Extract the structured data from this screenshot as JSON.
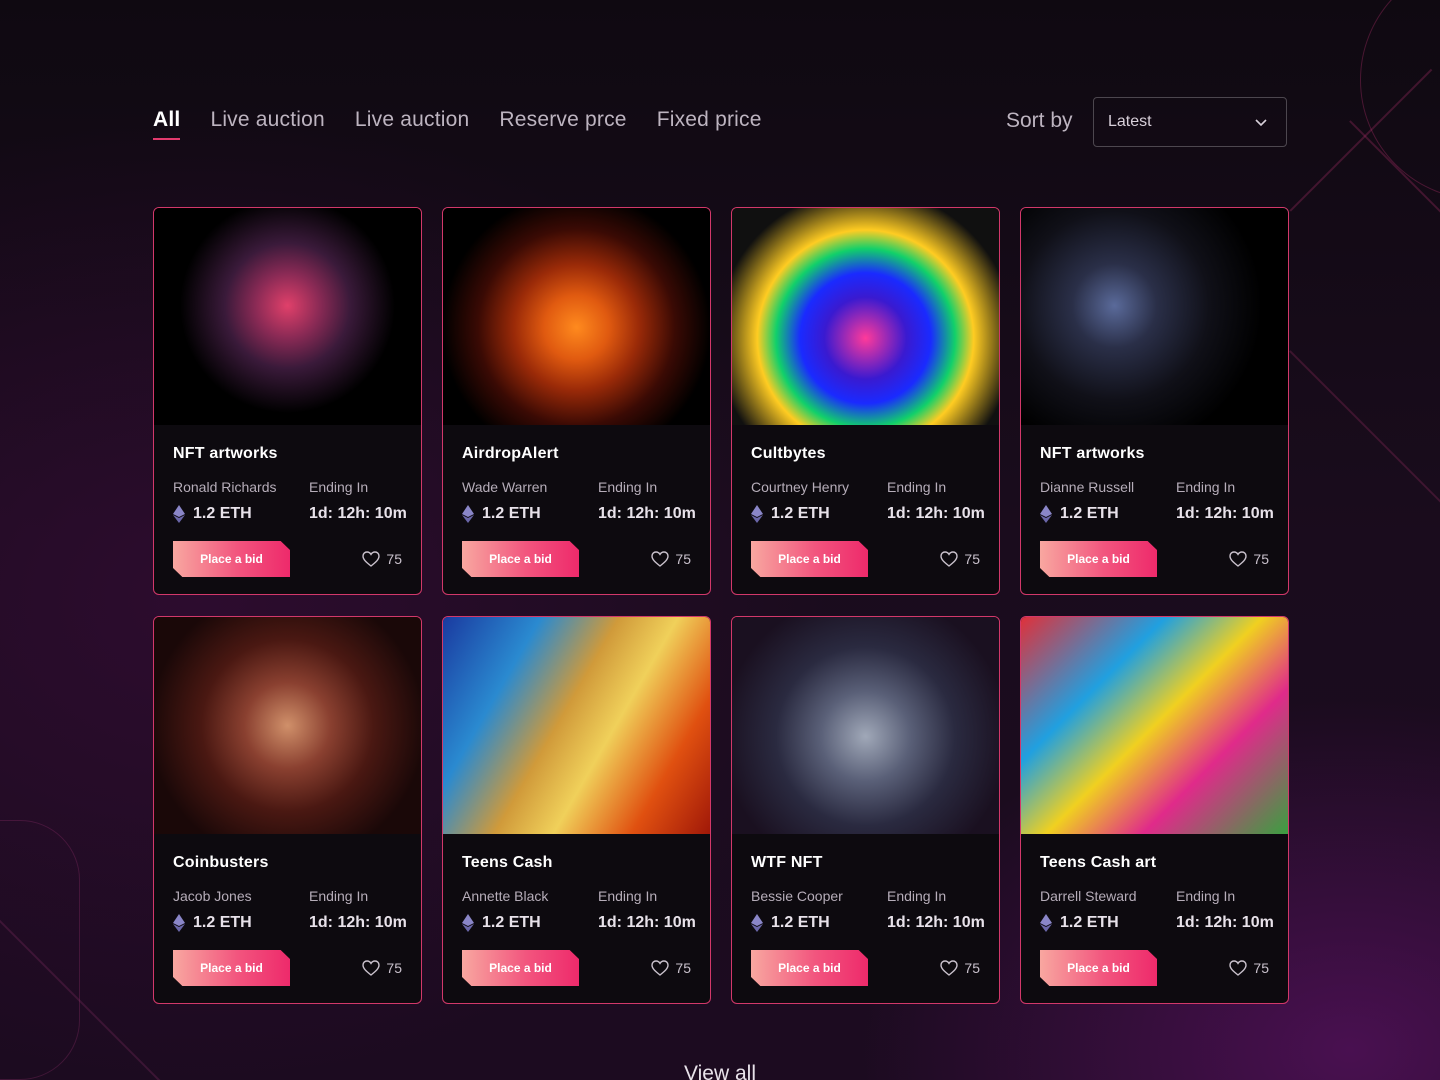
{
  "tabs": [
    {
      "label": "All",
      "active": true
    },
    {
      "label": "Live auction",
      "active": false
    },
    {
      "label": "Live auction",
      "active": false
    },
    {
      "label": "Reserve prce",
      "active": false
    },
    {
      "label": "Fixed price",
      "active": false
    }
  ],
  "sort": {
    "label": "Sort by",
    "value": "Latest",
    "icon": "chevron-down-icon"
  },
  "accent_color": "#e23a6d",
  "cards": [
    {
      "title": "NFT artworks",
      "owner": "Ronald Richards",
      "ending_label": "Ending In",
      "price": "1.2 ETH",
      "timer": "1d: 12h: 10m",
      "bid_label": "Place a bid",
      "likes": "75"
    },
    {
      "title": "AirdropAlert",
      "owner": "Wade Warren",
      "ending_label": "Ending In",
      "price": "1.2 ETH",
      "timer": "1d: 12h: 10m",
      "bid_label": "Place a bid",
      "likes": "75"
    },
    {
      "title": "Cultbytes",
      "owner": "Courtney Henry",
      "ending_label": "Ending In",
      "price": "1.2 ETH",
      "timer": "1d: 12h: 10m",
      "bid_label": "Place a bid",
      "likes": "75"
    },
    {
      "title": "NFT artworks",
      "owner": "Dianne Russell",
      "ending_label": "Ending In",
      "price": "1.2 ETH",
      "timer": "1d: 12h: 10m",
      "bid_label": "Place a bid",
      "likes": "75"
    },
    {
      "title": "Coinbusters",
      "owner": "Jacob Jones",
      "ending_label": "Ending In",
      "price": "1.2 ETH",
      "timer": "1d: 12h: 10m",
      "bid_label": "Place a bid",
      "likes": "75"
    },
    {
      "title": "Teens Cash",
      "owner": "Annette Black",
      "ending_label": "Ending In",
      "price": "1.2 ETH",
      "timer": "1d: 12h: 10m",
      "bid_label": "Place a bid",
      "likes": "75"
    },
    {
      "title": "WTF NFT",
      "owner": "Bessie Cooper",
      "ending_label": "Ending In",
      "price": "1.2 ETH",
      "timer": "1d: 12h: 10m",
      "bid_label": "Place a bid",
      "likes": "75"
    },
    {
      "title": "Teens Cash art",
      "owner": "Darrell Steward",
      "ending_label": "Ending In",
      "price": "1.2 ETH",
      "timer": "1d: 12h: 10m",
      "bid_label": "Place a bid",
      "likes": "75"
    }
  ],
  "view_all": "View all"
}
